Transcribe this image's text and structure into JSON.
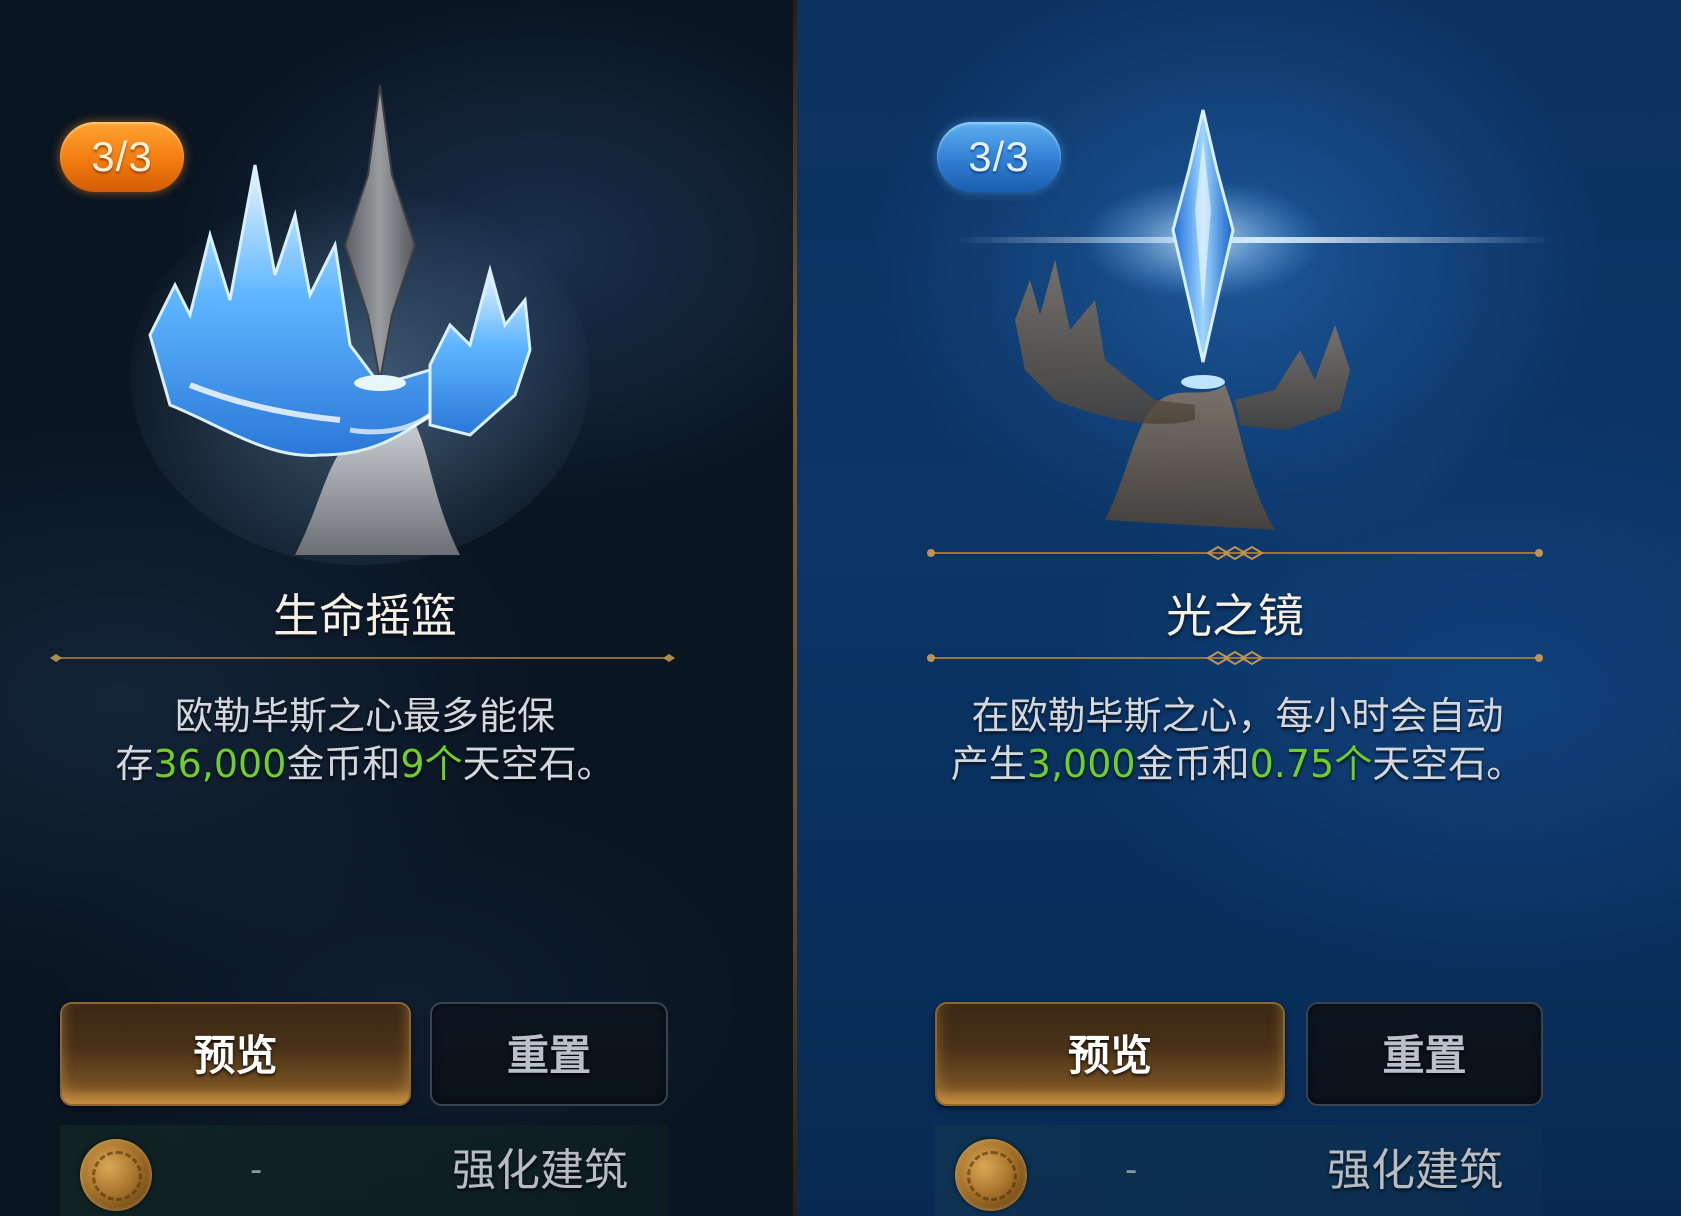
{
  "buildings": [
    {
      "level": "3/3",
      "name": "生命摇篮",
      "description": {
        "line1": "欧勒毕斯之心最多能保",
        "line2_prefix": "存",
        "gold_amount": "36,000",
        "middle": "金币和",
        "sky_amount": "9个",
        "suffix": "天空石。"
      },
      "preview_label": "预览",
      "reset_label": "重置",
      "cost": "-",
      "upgrade_label": "强化建筑",
      "badge_color": "#f27c0f"
    },
    {
      "level": "3/3",
      "name": "光之镜",
      "description": {
        "line1": "在欧勒毕斯之心，每小时会自动",
        "line2_prefix": "产生",
        "gold_amount": "3,000",
        "middle": "金币和",
        "sky_amount": "0.75个",
        "suffix": "天空石。"
      },
      "preview_label": "预览",
      "reset_label": "重置",
      "cost": "-",
      "upgrade_label": "强化建筑",
      "badge_color": "#2f7ed3"
    }
  ],
  "colors": {
    "highlight_green": "#6fce2a",
    "divider_gold": "#7a5a2c",
    "left_panel_bg": "#0a1522",
    "right_panel_bg": "#0a3566"
  },
  "icons": {
    "coin": "gold-coin-icon",
    "left_art": "floating-crystal-island-icon",
    "right_art": "light-mirror-crystal-icon"
  }
}
